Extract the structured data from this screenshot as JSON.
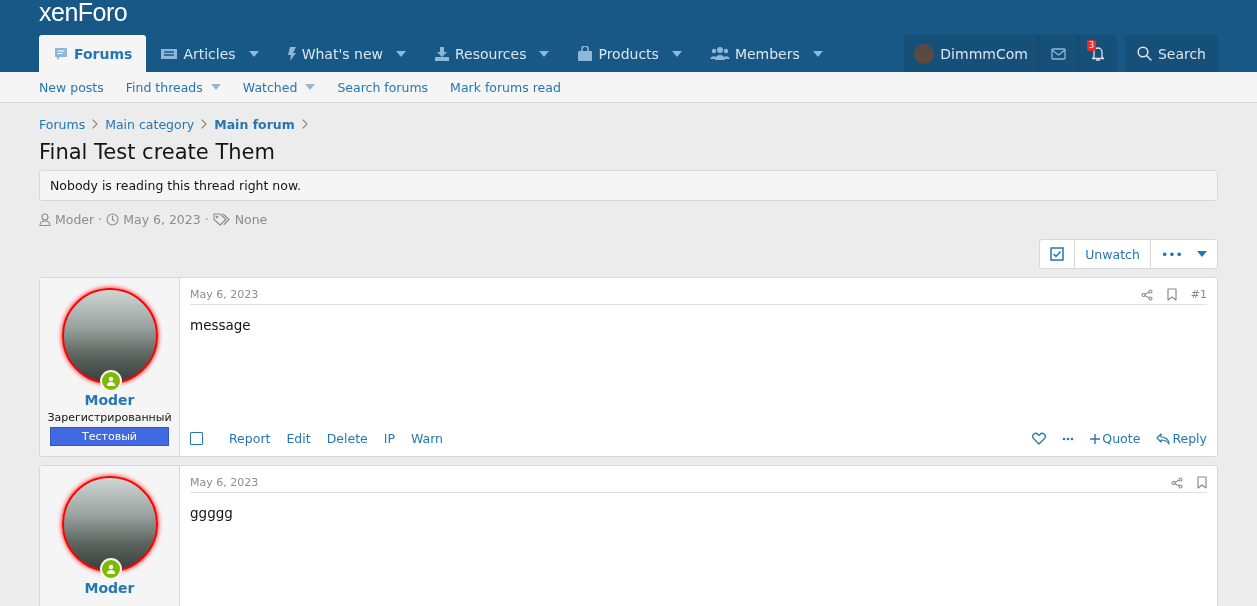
{
  "logo": "xenForo",
  "nav_tabs": [
    {
      "label": "Forums",
      "selected": true,
      "dropdown": false
    },
    {
      "label": "Articles",
      "selected": false,
      "dropdown": true
    },
    {
      "label": "What's new",
      "selected": false,
      "dropdown": true
    },
    {
      "label": "Resources",
      "selected": false,
      "dropdown": true
    },
    {
      "label": "Products",
      "selected": false,
      "dropdown": true
    },
    {
      "label": "Members",
      "selected": false,
      "dropdown": true
    }
  ],
  "account": {
    "username": "DimmmCom",
    "alerts_badge": "3"
  },
  "search_label": "Search",
  "sub_nav": [
    {
      "label": "New posts",
      "dropdown": false
    },
    {
      "label": "Find threads",
      "dropdown": true
    },
    {
      "label": "Watched",
      "dropdown": true
    },
    {
      "label": "Search forums",
      "dropdown": false
    },
    {
      "label": "Mark forums read",
      "dropdown": false
    }
  ],
  "breadcrumbs": [
    {
      "label": "Forums",
      "current": false
    },
    {
      "label": "Main category",
      "current": false
    },
    {
      "label": "Main forum",
      "current": true
    }
  ],
  "thread_title": "Final Test create Them",
  "notice": "Nobody is reading this thread right now.",
  "thread_meta": {
    "author": "Moder",
    "separator_1": "·",
    "date": "May 6, 2023",
    "separator_2": "·",
    "tags": "None"
  },
  "thread_actions": {
    "watch_checked": true,
    "unwatch_label": "Unwatch",
    "more_label": "•••"
  },
  "posts": [
    {
      "username": "Moder",
      "user_title": "Зарегистрированный",
      "banner": "Тестовый",
      "date": "May 6, 2023",
      "number": "#1",
      "message": "message",
      "selected": false,
      "left_actions": [
        "Report",
        "Edit",
        "Delete",
        "IP",
        "Warn"
      ],
      "right_actions": [
        "Quote",
        "Reply"
      ]
    },
    {
      "username": "Moder",
      "date": "May 6, 2023",
      "message": "ggggg"
    }
  ]
}
